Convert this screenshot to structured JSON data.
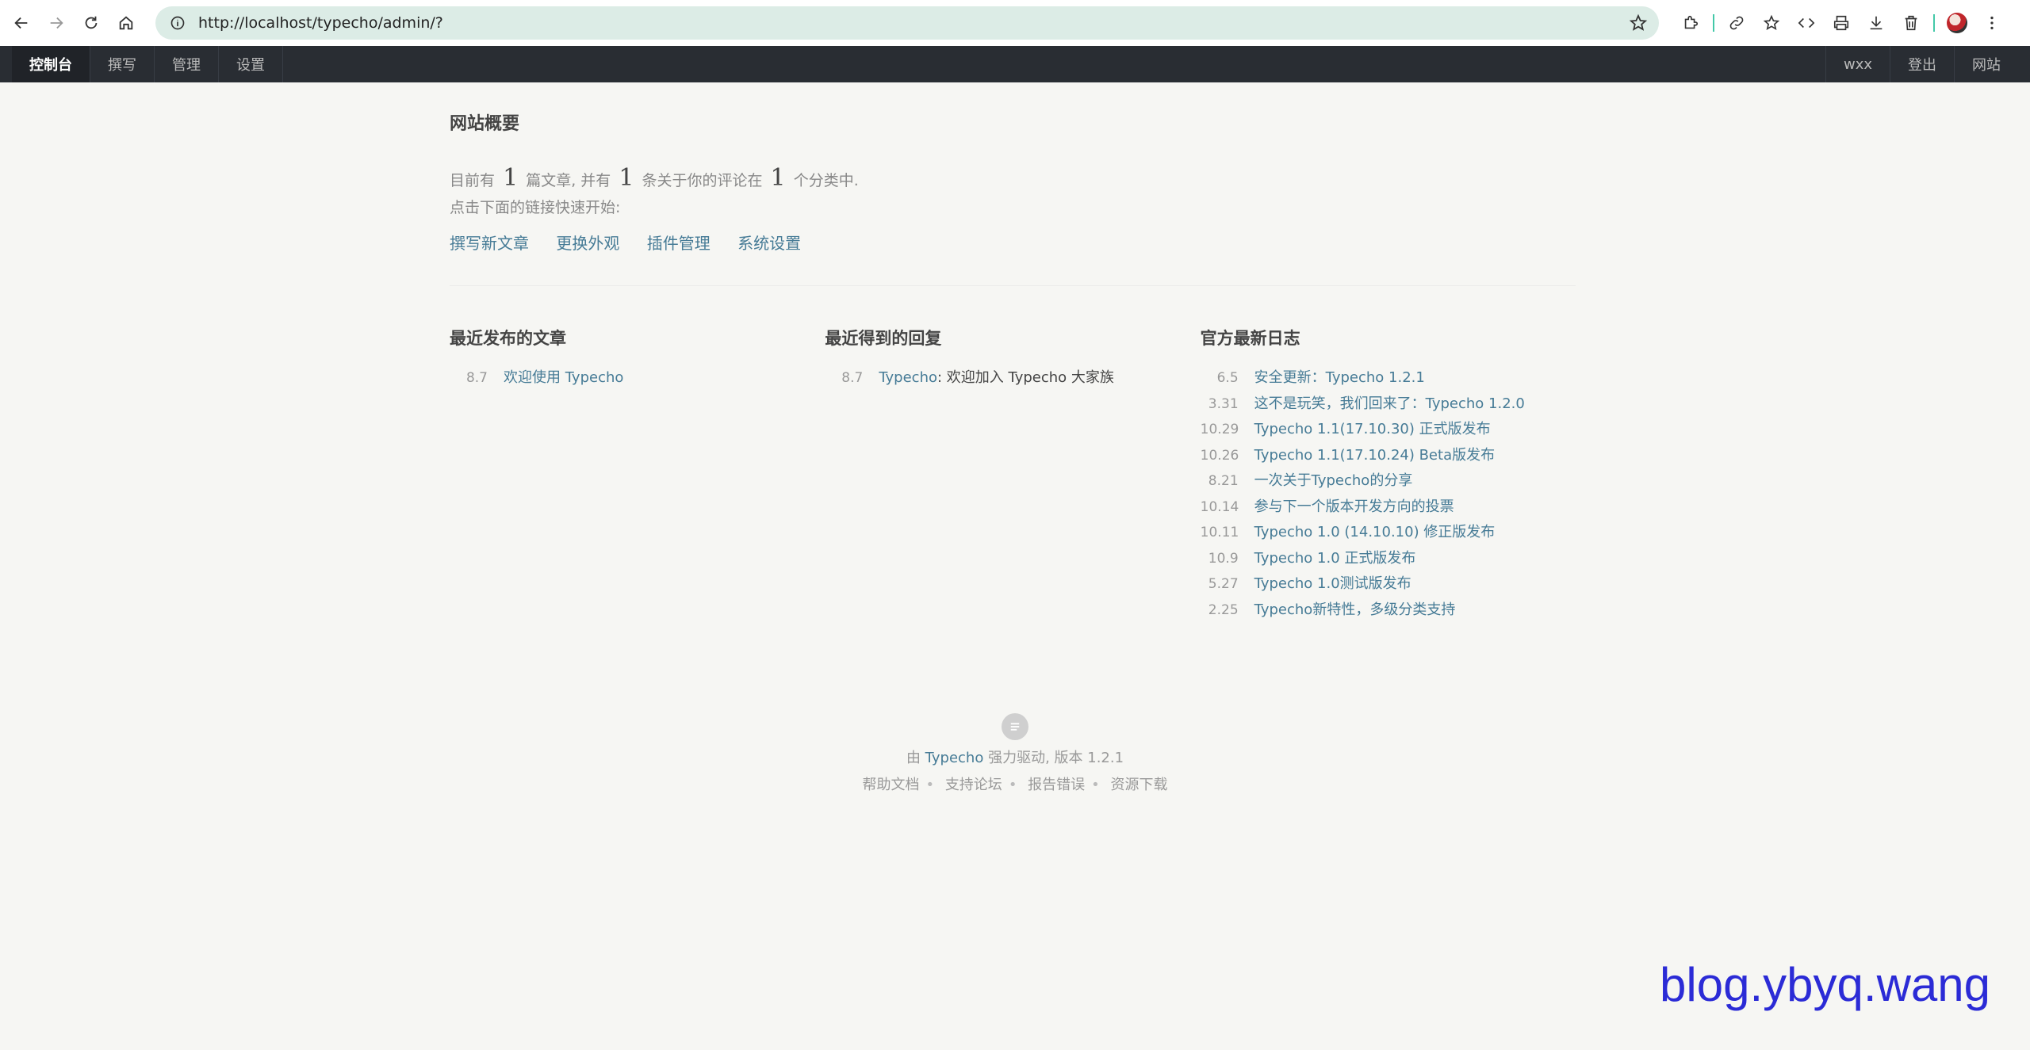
{
  "browser": {
    "url": "http://localhost/typecho/admin/?"
  },
  "nav": {
    "left": [
      {
        "label": "控制台",
        "active": true
      },
      {
        "label": "撰写",
        "active": false
      },
      {
        "label": "管理",
        "active": false
      },
      {
        "label": "设置",
        "active": false
      }
    ],
    "right": [
      {
        "label": "wxx"
      },
      {
        "label": "登出"
      },
      {
        "label": "网站"
      }
    ]
  },
  "overview": {
    "title": "网站概要",
    "p1": "目前有",
    "posts_count": "1",
    "p2": "篇文章, 并有",
    "comments_count": "1",
    "p3": "条关于你的评论在",
    "categories_count": "1",
    "p4": "个分类中.",
    "hint": "点击下面的链接快速开始:",
    "links": [
      "撰写新文章",
      "更换外观",
      "插件管理",
      "系统设置"
    ]
  },
  "recent_posts": {
    "title": "最近发布的文章",
    "items": [
      {
        "date": "8.7",
        "title": "欢迎使用 Typecho"
      }
    ]
  },
  "recent_comments": {
    "title": "最近得到的回复",
    "items": [
      {
        "date": "8.7",
        "author": "Typecho",
        "text": ": 欢迎加入 Typecho 大家族"
      }
    ]
  },
  "official_logs": {
    "title": "官方最新日志",
    "items": [
      {
        "date": "6.5",
        "title": "安全更新：Typecho 1.2.1"
      },
      {
        "date": "3.31",
        "title": "这不是玩笑，我们回来了：Typecho 1.2.0"
      },
      {
        "date": "10.29",
        "title": "Typecho 1.1(17.10.30) 正式版发布"
      },
      {
        "date": "10.26",
        "title": "Typecho 1.1(17.10.24) Beta版发布"
      },
      {
        "date": "8.21",
        "title": "一次关于Typecho的分享"
      },
      {
        "date": "10.14",
        "title": "参与下一个版本开发方向的投票"
      },
      {
        "date": "10.11",
        "title": "Typecho 1.0 (14.10.10) 修正版发布"
      },
      {
        "date": "10.9",
        "title": "Typecho 1.0 正式版发布"
      },
      {
        "date": "5.27",
        "title": "Typecho 1.0测试版发布"
      },
      {
        "date": "2.25",
        "title": "Typecho新特性，多级分类支持"
      }
    ]
  },
  "footer": {
    "prefix": "由",
    "brand": "Typecho",
    "suffix": "强力驱动, 版本 1.2.1",
    "links": [
      "帮助文档",
      "支持论坛",
      "报告错误",
      "资源下载"
    ]
  },
  "watermark": "blog.ybyq.wang"
}
